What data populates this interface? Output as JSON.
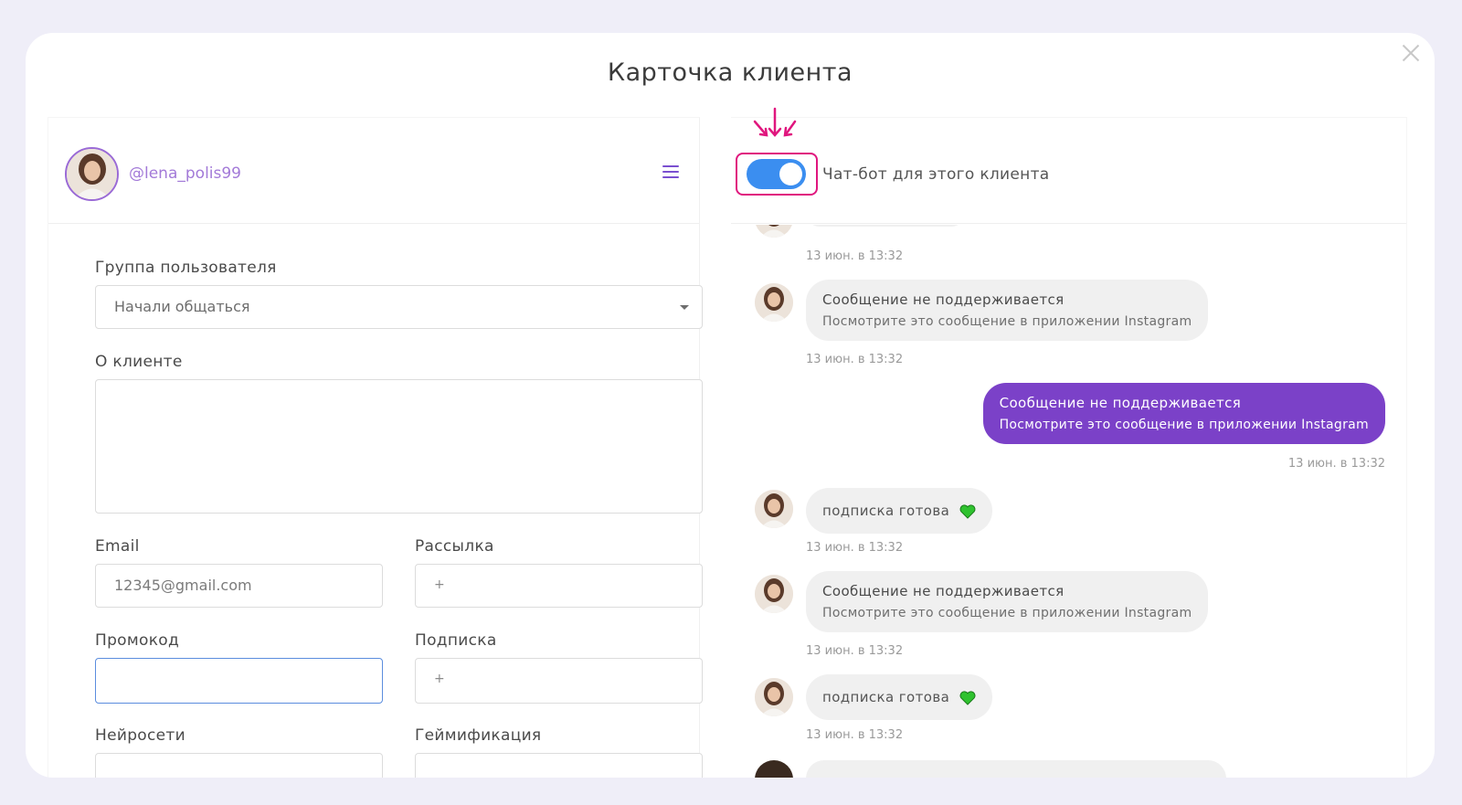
{
  "modal": {
    "title": "Карточка клиента"
  },
  "profile": {
    "username": "@lena_polis99"
  },
  "form": {
    "group_label": "Группа пользователя",
    "group_value": "Начали общаться",
    "about_label": "О клиенте",
    "about_value": "",
    "email_label": "Email",
    "email_value": "12345@gmail.com",
    "mailing_label": "Рассылка",
    "mailing_value": "+",
    "promo_label": "Промокод",
    "promo_value": "",
    "subscription_label": "Подписка",
    "subscription_value": "+",
    "neural_label": "Нейросети",
    "gamification_label": "Геймификация"
  },
  "chatbot": {
    "toggle_on": true,
    "label": "Чат-бот для этого клиента",
    "accent": "#3b8ef0",
    "highlight": "#e0167e"
  },
  "messages": [
    {
      "direction": "in",
      "time": "13 июн. в 13:32"
    },
    {
      "direction": "in",
      "title": "Сообщение не поддерживается",
      "subtitle": "Посмотрите это сообщение в приложении Instagram",
      "time": "13 июн. в 13:32"
    },
    {
      "direction": "out",
      "title": "Сообщение не поддерживается",
      "subtitle": "Посмотрите это сообщение в приложении Instagram",
      "time": "13 июн. в 13:32"
    },
    {
      "direction": "in",
      "text": "подписка готова",
      "emoji": "green-heart",
      "time": "13 июн. в 13:32"
    },
    {
      "direction": "in",
      "title": "Сообщение не поддерживается",
      "subtitle": "Посмотрите это сообщение в приложении Instagram",
      "time": "13 июн. в 13:32"
    },
    {
      "direction": "in",
      "text": "подписка готова",
      "emoji": "green-heart",
      "time": "13 июн. в 13:32"
    }
  ],
  "colors": {
    "brand_purple": "#7b41c8",
    "username": "#a37ad8"
  }
}
